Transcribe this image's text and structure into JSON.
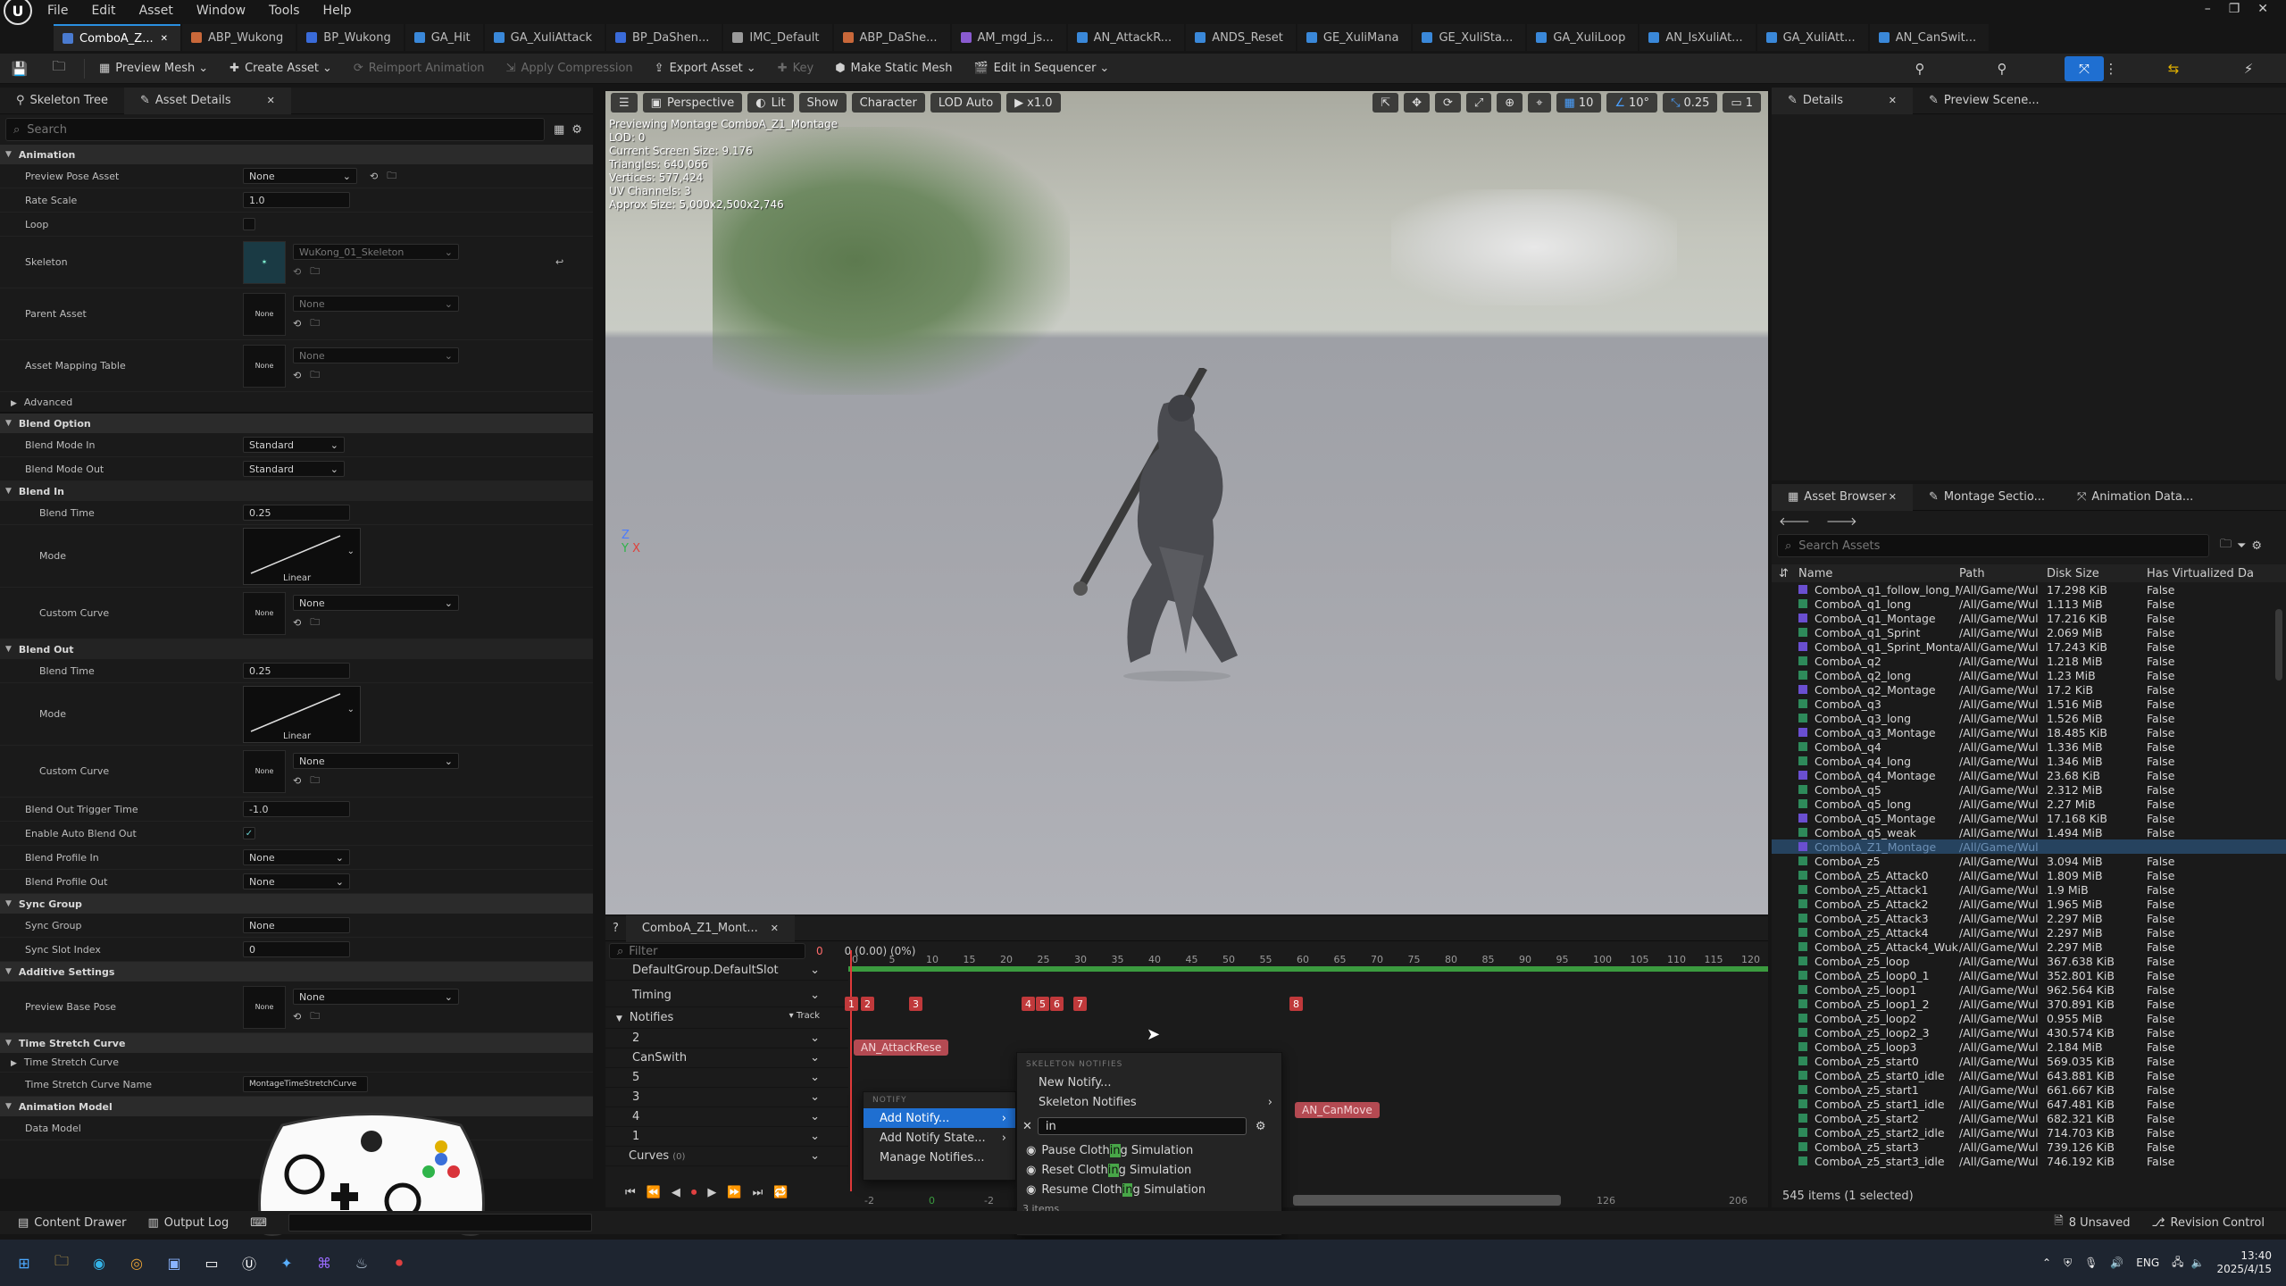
{
  "menu": [
    "File",
    "Edit",
    "Asset",
    "Window",
    "Tools",
    "Help"
  ],
  "doc_tabs": [
    {
      "label": "ComboA_Z...",
      "color": "#4a7bd0",
      "active": true
    },
    {
      "label": "ABP_Wukong",
      "color": "#c9683a"
    },
    {
      "label": "BP_Wukong",
      "color": "#3a6bd9"
    },
    {
      "label": "GA_Hit",
      "color": "#3a88d9"
    },
    {
      "label": "GA_XuliAttack",
      "color": "#3a88d9"
    },
    {
      "label": "BP_DaShen...",
      "color": "#3a6bd9"
    },
    {
      "label": "IMC_Default",
      "color": "#9a9a9a"
    },
    {
      "label": "ABP_DaShe...",
      "color": "#c9683a"
    },
    {
      "label": "AM_mgd_js...",
      "color": "#8a5bd0"
    },
    {
      "label": "AN_AttackR...",
      "color": "#3a88d9"
    },
    {
      "label": "ANDS_Reset",
      "color": "#3a88d9"
    },
    {
      "label": "GE_XuliMana",
      "color": "#3a88d9"
    },
    {
      "label": "GE_XuliSta...",
      "color": "#3a88d9"
    },
    {
      "label": "GA_XuliLoop",
      "color": "#3a88d9"
    },
    {
      "label": "AN_IsXuliAt...",
      "color": "#3a88d9"
    },
    {
      "label": "GA_XuliAtt...",
      "color": "#3a88d9"
    },
    {
      "label": "AN_CanSwit...",
      "color": "#3a88d9"
    }
  ],
  "toolbar": {
    "preview_mesh": "Preview Mesh",
    "create_asset": "Create Asset",
    "reimport": "Reimport Animation",
    "apply_compression": "Apply Compression",
    "export_asset": "Export Asset",
    "key": "Key",
    "make_static_mesh": "Make Static Mesh",
    "edit_in_sequencer": "Edit in Sequencer"
  },
  "left": {
    "tab1": "Skeleton Tree",
    "tab2": "Asset Details",
    "search_placeholder": "Search",
    "sec_animation": "Animation",
    "preview_pose_asset": "Preview Pose Asset",
    "preview_pose_value": "None",
    "rate_scale": "Rate Scale",
    "rate_scale_value": "1.0",
    "loop": "Loop",
    "skeleton": "Skeleton",
    "skeleton_value": "WuKong_01_Skeleton",
    "parent_asset": "Parent Asset",
    "asset_mapping": "Asset Mapping Table",
    "none": "None",
    "sec_advanced": "Advanced",
    "sec_blend_option": "Blend Option",
    "blend_mode_in": "Blend Mode In",
    "blend_mode_out": "Blend Mode Out",
    "standard": "Standard",
    "sec_blend_in": "Blend In",
    "blend_time": "Blend Time",
    "blend_time_value": "0.25",
    "mode": "Mode",
    "linear": "Linear",
    "custom_curve": "Custom Curve",
    "sec_blend_out": "Blend Out",
    "blend_out_trigger": "Blend Out Trigger Time",
    "blend_out_trigger_value": "-1.0",
    "enable_auto": "Enable Auto Blend Out",
    "blend_profile_in": "Blend Profile In",
    "blend_profile_out": "Blend Profile Out",
    "sec_sync": "Sync Group",
    "sync_group": "Sync Group",
    "sync_slot": "Sync Slot Index",
    "sync_slot_value": "0",
    "sec_additive": "Additive Settings",
    "preview_base_pose": "Preview Base Pose",
    "sec_time_stretch": "Time Stretch Curve",
    "time_stretch_curve": "Time Stretch Curve",
    "time_stretch_name": "Time Stretch Curve Name",
    "time_stretch_name_value": "MontageTimeStretchCurve",
    "sec_anim_model": "Animation Model",
    "data_model": "Data Model"
  },
  "viewport": {
    "perspective": "Perspective",
    "lit": "Lit",
    "show": "Show",
    "character": "Character",
    "lod": "LOD Auto",
    "speed": "x1.0",
    "grid": "10",
    "angle": "10°",
    "scale": "0.25",
    "cam": "1",
    "stats": [
      "Previewing Montage ComboA_Z1_Montage",
      "LOD: 0",
      "Current Screen Size: 9.176",
      "Triangles: 640,066",
      "Vertices: 577,424",
      "UV Channels: 3",
      "Approx Size: 5,000x2,500x2,746"
    ]
  },
  "right": {
    "details": "Details",
    "preview_scene": "Preview Scene..."
  },
  "asset_browser": {
    "tab1": "Asset Browser",
    "tab2": "Montage Sectio...",
    "tab3": "Animation Data...",
    "search_placeholder": "Search Assets",
    "col_name": "Name",
    "col_path": "Path",
    "col_size": "Disk Size",
    "col_virtual": "Has Virtualized Da",
    "status": "545 items (1 selected)",
    "rows": [
      {
        "name": "ComboA_q1_follow_long_M",
        "path": "/All/Game/Wul",
        "size": "17.298 KiB",
        "v": "False",
        "c": "#6a4fd0"
      },
      {
        "name": "ComboA_q1_long",
        "path": "/All/Game/Wul",
        "size": "1.113 MiB",
        "v": "False",
        "c": "#2e8a5a"
      },
      {
        "name": "ComboA_q1_Montage",
        "path": "/All/Game/Wul",
        "size": "17.216 KiB",
        "v": "False",
        "c": "#6a4fd0"
      },
      {
        "name": "ComboA_q1_Sprint",
        "path": "/All/Game/Wul",
        "size": "2.069 MiB",
        "v": "False",
        "c": "#2e8a5a"
      },
      {
        "name": "ComboA_q1_Sprint_Monta",
        "path": "/All/Game/Wul",
        "size": "17.243 KiB",
        "v": "False",
        "c": "#6a4fd0"
      },
      {
        "name": "ComboA_q2",
        "path": "/All/Game/Wul",
        "size": "1.218 MiB",
        "v": "False",
        "c": "#2e8a5a"
      },
      {
        "name": "ComboA_q2_long",
        "path": "/All/Game/Wul",
        "size": "1.23 MiB",
        "v": "False",
        "c": "#2e8a5a"
      },
      {
        "name": "ComboA_q2_Montage",
        "path": "/All/Game/Wul",
        "size": "17.2 KiB",
        "v": "False",
        "c": "#6a4fd0"
      },
      {
        "name": "ComboA_q3",
        "path": "/All/Game/Wul",
        "size": "1.516 MiB",
        "v": "False",
        "c": "#2e8a5a"
      },
      {
        "name": "ComboA_q3_long",
        "path": "/All/Game/Wul",
        "size": "1.526 MiB",
        "v": "False",
        "c": "#2e8a5a"
      },
      {
        "name": "ComboA_q3_Montage",
        "path": "/All/Game/Wul",
        "size": "18.485 KiB",
        "v": "False",
        "c": "#6a4fd0"
      },
      {
        "name": "ComboA_q4",
        "path": "/All/Game/Wul",
        "size": "1.336 MiB",
        "v": "False",
        "c": "#2e8a5a"
      },
      {
        "name": "ComboA_q4_long",
        "path": "/All/Game/Wul",
        "size": "1.346 MiB",
        "v": "False",
        "c": "#2e8a5a"
      },
      {
        "name": "ComboA_q4_Montage",
        "path": "/All/Game/Wul",
        "size": "23.68 KiB",
        "v": "False",
        "c": "#6a4fd0"
      },
      {
        "name": "ComboA_q5",
        "path": "/All/Game/Wul",
        "size": "2.312 MiB",
        "v": "False",
        "c": "#2e8a5a"
      },
      {
        "name": "ComboA_q5_long",
        "path": "/All/Game/Wul",
        "size": "2.27 MiB",
        "v": "False",
        "c": "#2e8a5a"
      },
      {
        "name": "ComboA_q5_Montage",
        "path": "/All/Game/Wul",
        "size": "17.168 KiB",
        "v": "False",
        "c": "#6a4fd0"
      },
      {
        "name": "ComboA_q5_weak",
        "path": "/All/Game/Wul",
        "size": "1.494 MiB",
        "v": "False",
        "c": "#2e8a5a"
      },
      {
        "name": "ComboA_Z1_Montage",
        "path": "/All/Game/Wul",
        "size": "",
        "v": "",
        "c": "#6a4fd0",
        "sel": true
      },
      {
        "name": "ComboA_z5",
        "path": "/All/Game/Wul",
        "size": "3.094 MiB",
        "v": "False",
        "c": "#2e8a5a"
      },
      {
        "name": "ComboA_z5_Attack0",
        "path": "/All/Game/Wul",
        "size": "1.809 MiB",
        "v": "False",
        "c": "#2e8a5a"
      },
      {
        "name": "ComboA_z5_Attack1",
        "path": "/All/Game/Wul",
        "size": "1.9 MiB",
        "v": "False",
        "c": "#2e8a5a"
      },
      {
        "name": "ComboA_z5_Attack2",
        "path": "/All/Game/Wul",
        "size": "1.965 MiB",
        "v": "False",
        "c": "#2e8a5a"
      },
      {
        "name": "ComboA_z5_Attack3",
        "path": "/All/Game/Wul",
        "size": "2.297 MiB",
        "v": "False",
        "c": "#2e8a5a"
      },
      {
        "name": "ComboA_z5_Attack4",
        "path": "/All/Game/Wul",
        "size": "2.297 MiB",
        "v": "False",
        "c": "#2e8a5a"
      },
      {
        "name": "ComboA_z5_Attack4_Wuk",
        "path": "/All/Game/Wul",
        "size": "2.297 MiB",
        "v": "False",
        "c": "#2e8a5a"
      },
      {
        "name": "ComboA_z5_loop",
        "path": "/All/Game/Wul",
        "size": "367.638 KiB",
        "v": "False",
        "c": "#2e8a5a"
      },
      {
        "name": "ComboA_z5_loop0_1",
        "path": "/All/Game/Wul",
        "size": "352.801 KiB",
        "v": "False",
        "c": "#2e8a5a"
      },
      {
        "name": "ComboA_z5_loop1",
        "path": "/All/Game/Wul",
        "size": "962.564 KiB",
        "v": "False",
        "c": "#2e8a5a"
      },
      {
        "name": "ComboA_z5_loop1_2",
        "path": "/All/Game/Wul",
        "size": "370.891 KiB",
        "v": "False",
        "c": "#2e8a5a"
      },
      {
        "name": "ComboA_z5_loop2",
        "path": "/All/Game/Wul",
        "size": "0.955 MiB",
        "v": "False",
        "c": "#2e8a5a"
      },
      {
        "name": "ComboA_z5_loop2_3",
        "path": "/All/Game/Wul",
        "size": "430.574 KiB",
        "v": "False",
        "c": "#2e8a5a"
      },
      {
        "name": "ComboA_z5_loop3",
        "path": "/All/Game/Wul",
        "size": "2.184 MiB",
        "v": "False",
        "c": "#2e8a5a"
      },
      {
        "name": "ComboA_z5_start0",
        "path": "/All/Game/Wul",
        "size": "569.035 KiB",
        "v": "False",
        "c": "#2e8a5a"
      },
      {
        "name": "ComboA_z5_start0_idle",
        "path": "/All/Game/Wul",
        "size": "643.881 KiB",
        "v": "False",
        "c": "#2e8a5a"
      },
      {
        "name": "ComboA_z5_start1",
        "path": "/All/Game/Wul",
        "size": "661.667 KiB",
        "v": "False",
        "c": "#2e8a5a"
      },
      {
        "name": "ComboA_z5_start1_idle",
        "path": "/All/Game/Wul",
        "size": "647.481 KiB",
        "v": "False",
        "c": "#2e8a5a"
      },
      {
        "name": "ComboA_z5_start2",
        "path": "/All/Game/Wul",
        "size": "682.321 KiB",
        "v": "False",
        "c": "#2e8a5a"
      },
      {
        "name": "ComboA_z5_start2_idle",
        "path": "/All/Game/Wul",
        "size": "714.703 KiB",
        "v": "False",
        "c": "#2e8a5a"
      },
      {
        "name": "ComboA_z5_start3",
        "path": "/All/Game/Wul",
        "size": "739.126 KiB",
        "v": "False",
        "c": "#2e8a5a"
      },
      {
        "name": "ComboA_z5_start3_idle",
        "path": "/All/Game/Wul",
        "size": "746.192 KiB",
        "v": "False",
        "c": "#2e8a5a"
      }
    ]
  },
  "sequencer": {
    "tab": "ComboA_Z1_Mont...",
    "filter_placeholder": "Filter",
    "frame": "0",
    "time": "0 (0.00) (0%)",
    "slot": "DefaultGroup.DefaultSlot",
    "timing": "Timing",
    "notifies": "Notifies",
    "track_btn": "Track",
    "tracks": [
      "2",
      "CanSwith",
      "5",
      "3",
      "4",
      "1"
    ],
    "curves": "Curves",
    "curves_count": "(0)",
    "timing_markers": [
      "1",
      "2",
      "3",
      "4",
      "5",
      "6",
      "7",
      "8"
    ],
    "notify_attack": "AN_AttackRese",
    "notify_canmove": "AN_CanMove",
    "ruler": [
      "0",
      "5",
      "10",
      "15",
      "20",
      "25",
      "30",
      "35",
      "40",
      "45",
      "50",
      "55",
      "60",
      "65",
      "70",
      "75",
      "80",
      "85",
      "90",
      "95",
      "100",
      "105",
      "110",
      "115",
      "120"
    ],
    "bottom_left": "-2",
    "bottom_left2": "-2",
    "bottom_zero": "0",
    "bottom_r1": "126",
    "bottom_r2": "206"
  },
  "ctx_menu": {
    "header": "NOTIFY",
    "add_notify": "Add Notify...",
    "add_notify_state": "Add Notify State...",
    "manage": "Manage Notifies..."
  },
  "sub_menu": {
    "header": "SKELETON NOTIFIES",
    "new_notify": "New Notify...",
    "skeleton_notifies": "Skeleton Notifies",
    "search_value": "in",
    "results": [
      {
        "pre": "Pause Cloth",
        "hl": "in",
        "post": "g Simulation"
      },
      {
        "pre": "Reset Cloth",
        "hl": "in",
        "post": "g Simulation"
      },
      {
        "pre": "Resume Cloth",
        "hl": "in",
        "post": "g Simulation"
      }
    ],
    "count": "3 items"
  },
  "status": {
    "content_drawer": "Content Drawer",
    "output_log": "Output Log",
    "unsaved": "8 Unsaved",
    "revision": "Revision Control"
  },
  "taskbar": {
    "lang": "ENG",
    "time": "13:40",
    "date": "2025/4/15"
  }
}
